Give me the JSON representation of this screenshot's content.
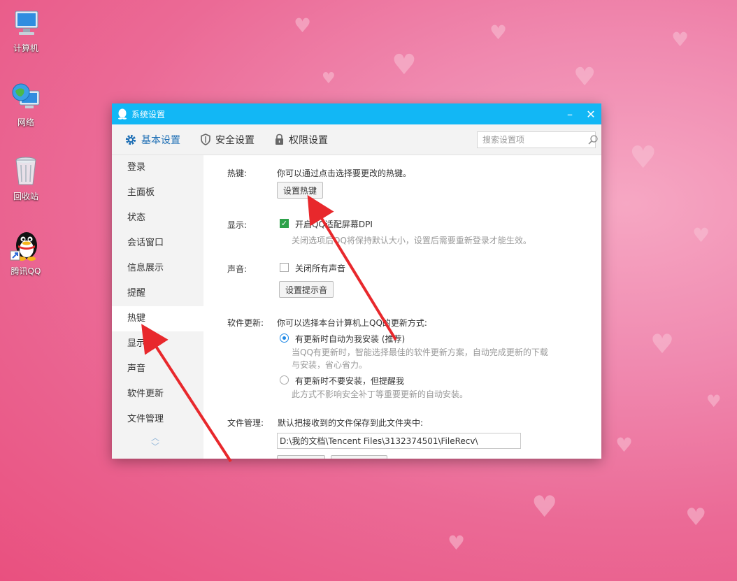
{
  "desktop": {
    "icons": [
      {
        "label": "计算机",
        "icon": "computer-icon"
      },
      {
        "label": "网络",
        "icon": "network-icon"
      },
      {
        "label": "回收站",
        "icon": "recycle-bin-icon"
      },
      {
        "label": "腾讯QQ",
        "icon": "qq-penguin-icon"
      }
    ]
  },
  "window": {
    "title": "系统设置",
    "minimize": "–",
    "close": "✕",
    "accent": "#12b7f5"
  },
  "tabs": [
    {
      "label": "基本设置",
      "icon": "gear-icon",
      "active": true
    },
    {
      "label": "安全设置",
      "icon": "shield-icon",
      "active": false
    },
    {
      "label": "权限设置",
      "icon": "lock-icon",
      "active": false
    }
  ],
  "search": {
    "placeholder": "搜索设置项"
  },
  "sidebar": {
    "items": [
      {
        "label": "登录"
      },
      {
        "label": "主面板"
      },
      {
        "label": "状态"
      },
      {
        "label": "会话窗口"
      },
      {
        "label": "信息展示"
      },
      {
        "label": "提醒"
      },
      {
        "label": "热键",
        "active": true
      },
      {
        "label": "显示"
      },
      {
        "label": "声音"
      },
      {
        "label": "软件更新"
      },
      {
        "label": "文件管理"
      }
    ],
    "scroll_up": "︿",
    "scroll_down": "﹀"
  },
  "settings": {
    "hotkey": {
      "label": "热键:",
      "desc": "你可以通过点击选择要更改的热键。",
      "button": "设置热键"
    },
    "display": {
      "label": "显示:",
      "checkbox_label": "开启QQ适配屏幕DPI",
      "checked": true,
      "hint": "关闭选项后QQ将保持默认大小，设置后需要重新登录才能生效。"
    },
    "sound": {
      "label": "声音:",
      "checkbox_label": "关闭所有声音",
      "checked": false,
      "button": "设置提示音"
    },
    "update": {
      "label": "软件更新:",
      "desc": "你可以选择本台计算机上QQ的更新方式:",
      "option1": "有更新时自动为我安装 (推荐)",
      "option1_hint1": "当QQ有更新时，智能选择最佳的软件更新方案，自动完成更新的下载",
      "option1_hint2": "与安装，省心省力。",
      "option2": "有更新时不要安装，但提醒我",
      "option2_hint": "此方式不影响安全补丁等重要更新的自动安装。"
    },
    "files": {
      "label": "文件管理:",
      "desc": "默认把接收到的文件保存到此文件夹中:",
      "path": "D:\\我的文档\\Tencent Files\\3132374501\\FileRecv\\"
    }
  }
}
